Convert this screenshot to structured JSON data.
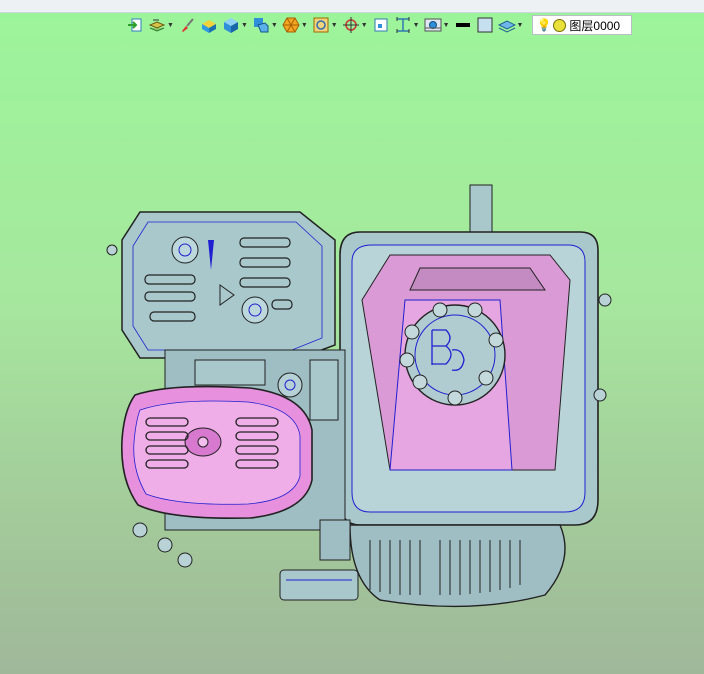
{
  "toolbar": {
    "items": [
      {
        "icon": "exit-view-icon",
        "dropdown": false
      },
      {
        "icon": "layers-stack-icon",
        "dropdown": true
      },
      {
        "icon": "brush-icon",
        "dropdown": false
      },
      {
        "icon": "shaded-box-icon",
        "dropdown": false
      },
      {
        "icon": "cube-icon",
        "dropdown": true
      },
      {
        "icon": "view-orientation-icon",
        "dropdown": true
      },
      {
        "icon": "polygon-select-icon",
        "dropdown": true
      },
      {
        "icon": "wireframe-cube-icon",
        "dropdown": true
      },
      {
        "icon": "crosshair-icon",
        "dropdown": true
      },
      {
        "icon": "frame-icon",
        "dropdown": false
      },
      {
        "icon": "dimension-icon",
        "dropdown": true
      },
      {
        "icon": "render-settings-icon",
        "dropdown": true
      },
      {
        "icon": "line-color-swatch-icon",
        "dropdown": false
      },
      {
        "icon": "fill-color-swatch-icon",
        "dropdown": false
      },
      {
        "icon": "layer-visibility-icon",
        "dropdown": true
      }
    ],
    "layer_selector": {
      "value": "图层0000",
      "state_color": "#e9e03a"
    }
  },
  "viewport": {
    "background_top": "#9cf59a",
    "background_bottom": "#9fb89a",
    "model": "engine-wireframe-shaded",
    "colors": {
      "body": "#a8c8cc",
      "highlight": "#e88de0",
      "edges": "#2a2a2a",
      "feature_edges": "#2020d0"
    }
  }
}
